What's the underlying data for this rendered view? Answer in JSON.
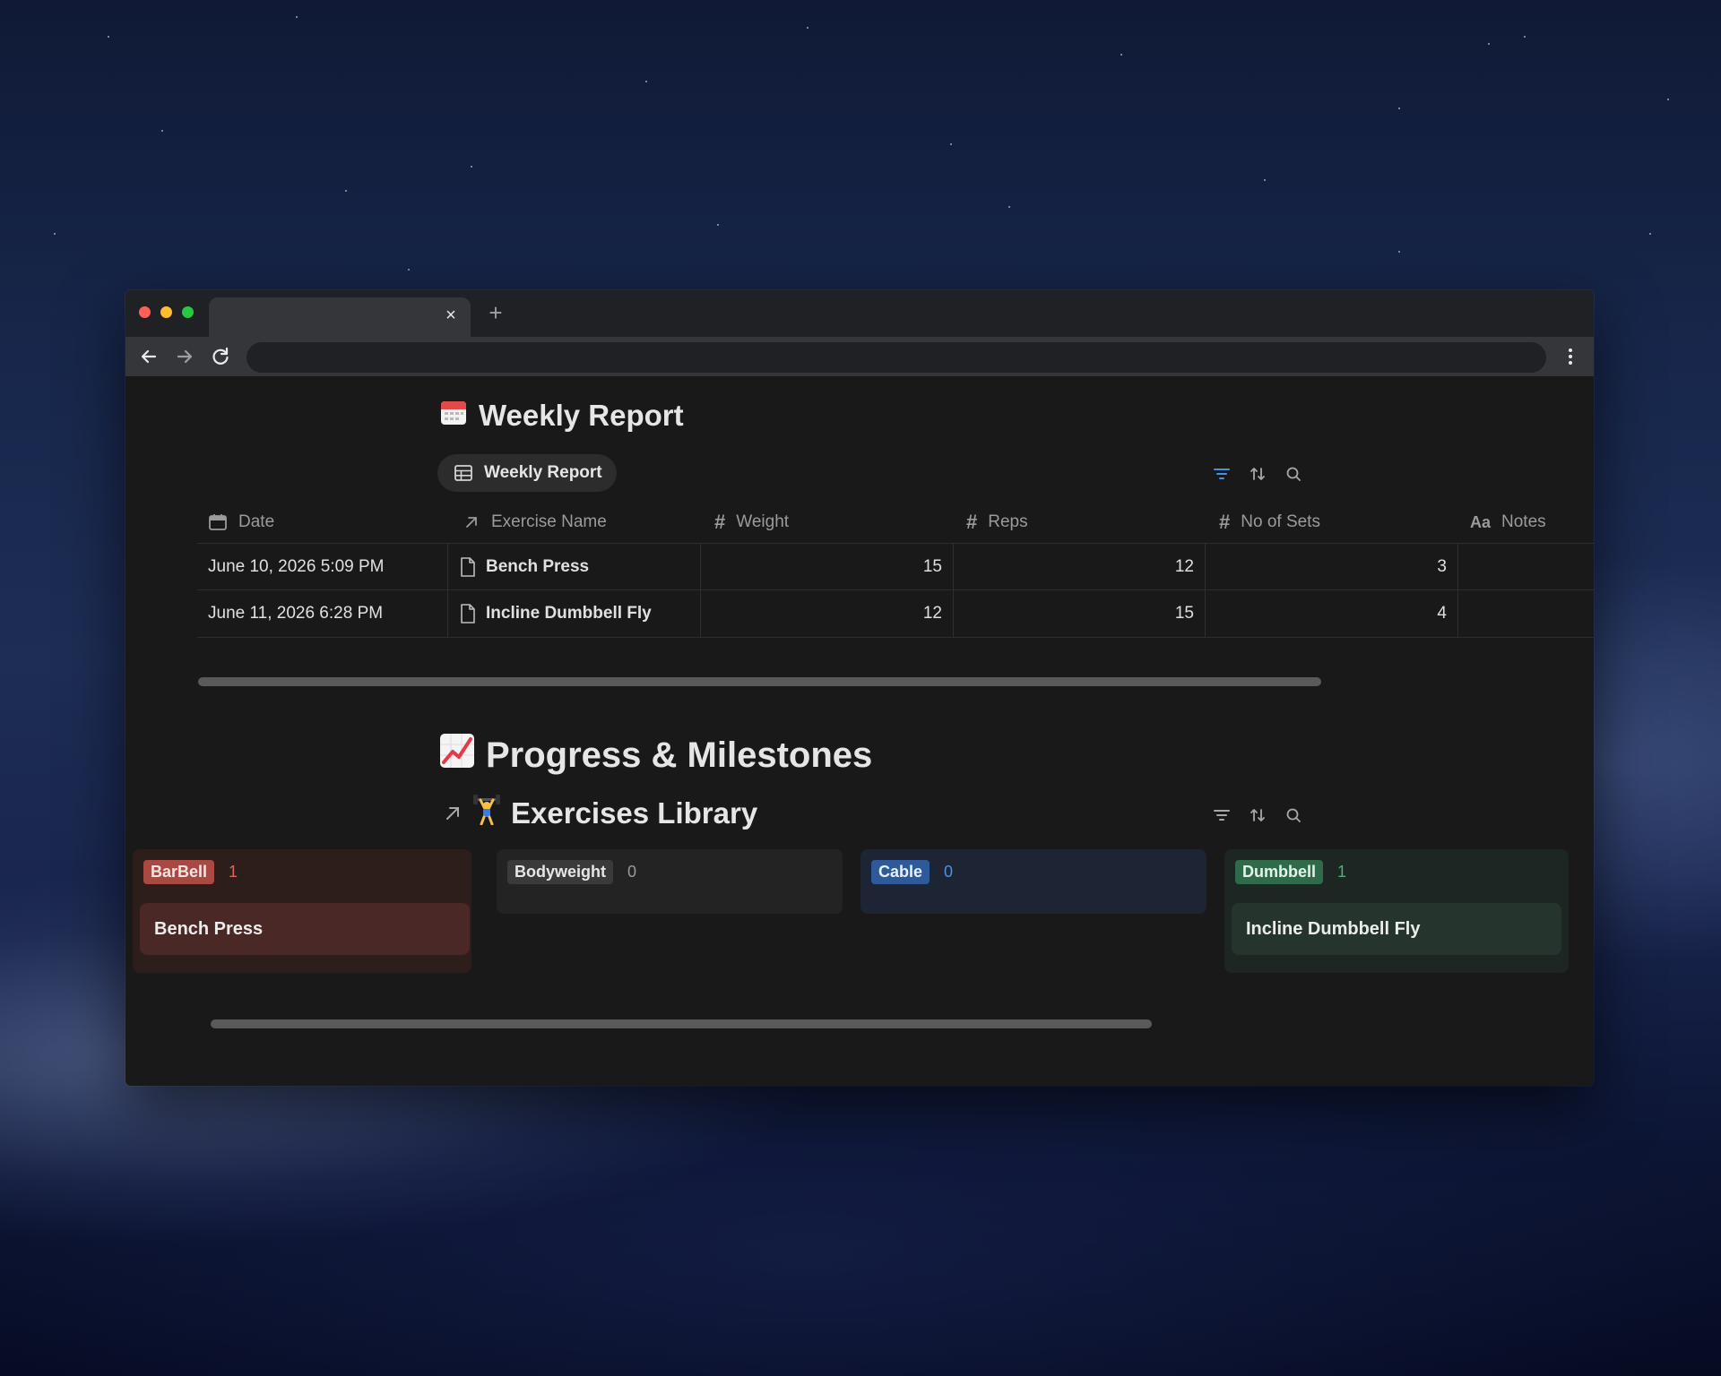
{
  "window": {
    "tab_close": "×",
    "new_tab": "+"
  },
  "weekly": {
    "emoji": "📅",
    "title": "Weekly Report",
    "view_label": "Weekly Report",
    "columns": [
      {
        "icon": "calendar-icon",
        "label": "Date"
      },
      {
        "icon": "relation-arrow-icon",
        "label": "Exercise Name"
      },
      {
        "icon": "#",
        "label": "Weight"
      },
      {
        "icon": "#",
        "label": "Reps"
      },
      {
        "icon": "#",
        "label": "No of Sets"
      },
      {
        "icon": "Aa",
        "label": "Notes"
      }
    ],
    "rows": [
      {
        "date": "June 10, 2026 5:09 PM",
        "exercise": "Bench Press",
        "weight": "15",
        "reps": "12",
        "sets": "3",
        "notes": ""
      },
      {
        "date": "June 11, 2026 6:28 PM",
        "exercise": "Incline Dumbbell Fly",
        "weight": "12",
        "reps": "15",
        "sets": "4",
        "notes": ""
      }
    ]
  },
  "progress": {
    "emoji": "📈",
    "title": "Progress & Milestones",
    "library_emoji": "🏋",
    "library_title": "Exercises Library",
    "groups": [
      {
        "label": "BarBell",
        "count": "1",
        "cards": [
          "Bench Press"
        ],
        "color": "#a94a42"
      },
      {
        "label": "Bodyweight",
        "count": "0",
        "cards": [],
        "color": "#3a3a3a"
      },
      {
        "label": "Cable",
        "count": "0",
        "cards": [],
        "color": "#2f5a99"
      },
      {
        "label": "Dumbbell",
        "count": "1",
        "cards": [
          "Incline Dumbbell Fly"
        ],
        "color": "#2f6a4a"
      }
    ]
  }
}
